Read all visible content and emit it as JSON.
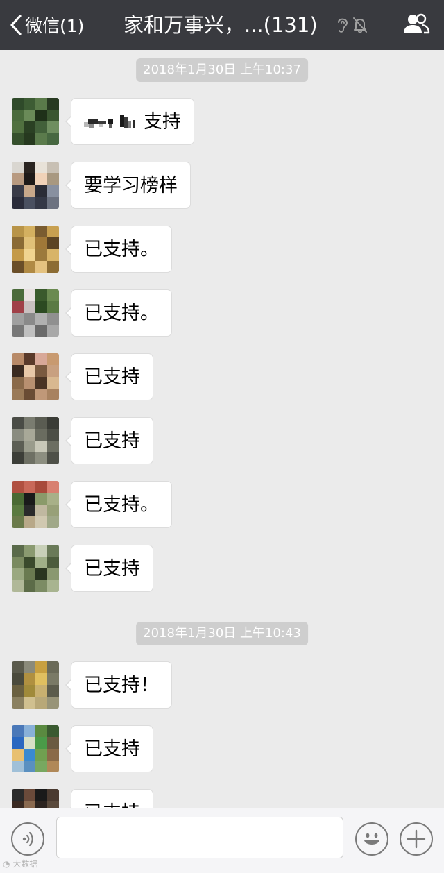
{
  "nav": {
    "back_label": "微信(1)",
    "title": "家和万事兴，...(131)",
    "status_icons": [
      "ear-icon",
      "mute-bell-icon"
    ],
    "members_icon": "group-members-icon"
  },
  "timestamps": [
    "2018年1月30日 上午10:37",
    "2018年1月30日 上午10:43"
  ],
  "messages": [
    {
      "text": "支持",
      "avatar": [
        "#2f4a2a",
        "#3d5c34",
        "#5a7a4a",
        "#283a22",
        "#4a6b3c",
        "#6a8a58",
        "#1f3019",
        "#3a5530",
        "#50703f",
        "#2a4023",
        "#42603a",
        "#6f8e60",
        "#35502c",
        "#26391f",
        "#5b7b4c",
        "#476841"
      ],
      "redacted_prefix": true
    },
    {
      "text": "要学习榜样",
      "avatar": [
        "#d9d6d0",
        "#2a2420",
        "#e8e2d8",
        "#c8c0b4",
        "#b89a80",
        "#1e1a18",
        "#f0d2b8",
        "#a89880",
        "#3a3c48",
        "#c8a88a",
        "#2a2c36",
        "#8890a0",
        "#2a2c3a",
        "#4a5060",
        "#343846",
        "#6c7280"
      ]
    },
    {
      "text": "已支持。",
      "avatar": [
        "#b89448",
        "#d4b060",
        "#7a5c30",
        "#c8a050",
        "#8a6a34",
        "#e0c078",
        "#a07838",
        "#5c4424",
        "#c49a48",
        "#f0d490",
        "#9c7a3c",
        "#d8b468",
        "#6a4e28",
        "#b08a44",
        "#e4c280",
        "#8c6c34"
      ]
    },
    {
      "text": "已支持。",
      "avatar": [
        "#4a6a3a",
        "#e8e0e0",
        "#3a5a2c",
        "#6a8a50",
        "#a04048",
        "#c8c0c0",
        "#2c4a22",
        "#5a7a44",
        "#a0a0a0",
        "#8a8a8a",
        "#b0b0b0",
        "#909090",
        "#787878",
        "#c0c0c0",
        "#6a6a6a",
        "#a8a8a8"
      ]
    },
    {
      "text": "已支持",
      "avatar": [
        "#b88a68",
        "#5a3a2a",
        "#d8a898",
        "#c89a70",
        "#3a2a20",
        "#e8c8a8",
        "#7a5a40",
        "#c8a080",
        "#8a6a4a",
        "#b89070",
        "#4a3424",
        "#d8b890",
        "#9a7a58",
        "#6a4c34",
        "#c09878",
        "#a88260"
      ]
    },
    {
      "text": "已支持",
      "avatar": [
        "#4a4c46",
        "#7a7c70",
        "#5a5c52",
        "#3a3c36",
        "#8a8c80",
        "#a8a898",
        "#6a6c60",
        "#4c4e46",
        "#5c5e54",
        "#9a9c8c",
        "#c8c8b8",
        "#6c6e62",
        "#3c3e38",
        "#6e7064",
        "#8c8e80",
        "#4e5048"
      ]
    },
    {
      "text": "已支持。",
      "avatar": [
        "#b05040",
        "#c86858",
        "#a84a3a",
        "#d88070",
        "#4a6a34",
        "#1a1a1a",
        "#8a9a6a",
        "#a8b088",
        "#5a7a40",
        "#2a2a2a",
        "#c0b8a0",
        "#98a078",
        "#6a7a4a",
        "#b8a888",
        "#d0c8b0",
        "#a0a888"
      ]
    },
    {
      "text": "已支持",
      "avatar": [
        "#5a6a4a",
        "#8a9a70",
        "#c8d0b8",
        "#6a7a58",
        "#7a8a60",
        "#3a4a2c",
        "#a0b088",
        "#4c5c3c",
        "#9aa880",
        "#6a7a50",
        "#2a3620",
        "#8a9870",
        "#b0b898",
        "#5c6c48",
        "#7c8c64",
        "#a8b490"
      ]
    },
    {
      "text": "已支持！",
      "avatar": [
        "#5a5a4c",
        "#8a8a7a",
        "#c8a040",
        "#6a6a58",
        "#4a4a3c",
        "#b09040",
        "#e0c060",
        "#7a7a66",
        "#6a6040",
        "#a08a3a",
        "#c8b070",
        "#5c5c4c",
        "#8a8060",
        "#d0c090",
        "#b8a878",
        "#989478"
      ]
    },
    {
      "text": "已支持",
      "avatar": [
        "#4a78b8",
        "#88b0d8",
        "#5a8a40",
        "#3a5a30",
        "#2a68c0",
        "#d8e0c8",
        "#4a9a48",
        "#6a5a40",
        "#e8c070",
        "#3a8ad0",
        "#70a050",
        "#8a6a48",
        "#a0c0d8",
        "#5a90c0",
        "#78a860",
        "#b08858"
      ]
    },
    {
      "text": "已支持",
      "avatar": [
        "#2a2a2a",
        "#6a4a3a",
        "#1a1a1a",
        "#4a3a30",
        "#3a2a22",
        "#8a6a50",
        "#2c2420",
        "#5a4a3c"
      ]
    }
  ],
  "input": {
    "voice_icon": "voice-icon",
    "emoji_icon": "emoji-icon",
    "plus_icon": "plus-icon"
  },
  "watermark": "大数据"
}
